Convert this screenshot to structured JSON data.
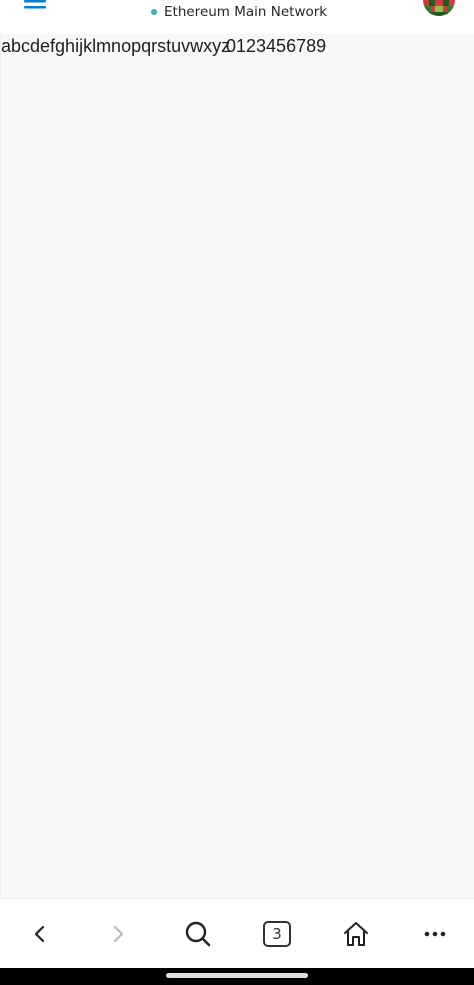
{
  "header": {
    "network_name": "Ethereum Main Network",
    "network_status_color": "#29b6af",
    "menu_icon": "hamburger-menu-icon",
    "avatar_icon": "identicon-avatar",
    "accent_color": "#037dd6"
  },
  "content": {
    "letters": "abcdefghijklmnopqrstuvwxyz",
    "digits": "0123456789",
    "background_color": "#f8f8f8"
  },
  "bottom_nav": {
    "back_icon": "chevron-left-icon",
    "forward_icon": "chevron-right-icon",
    "search_icon": "search-icon",
    "tabs_count": "3",
    "home_icon": "home-icon",
    "more_icon": "more-options-icon"
  }
}
